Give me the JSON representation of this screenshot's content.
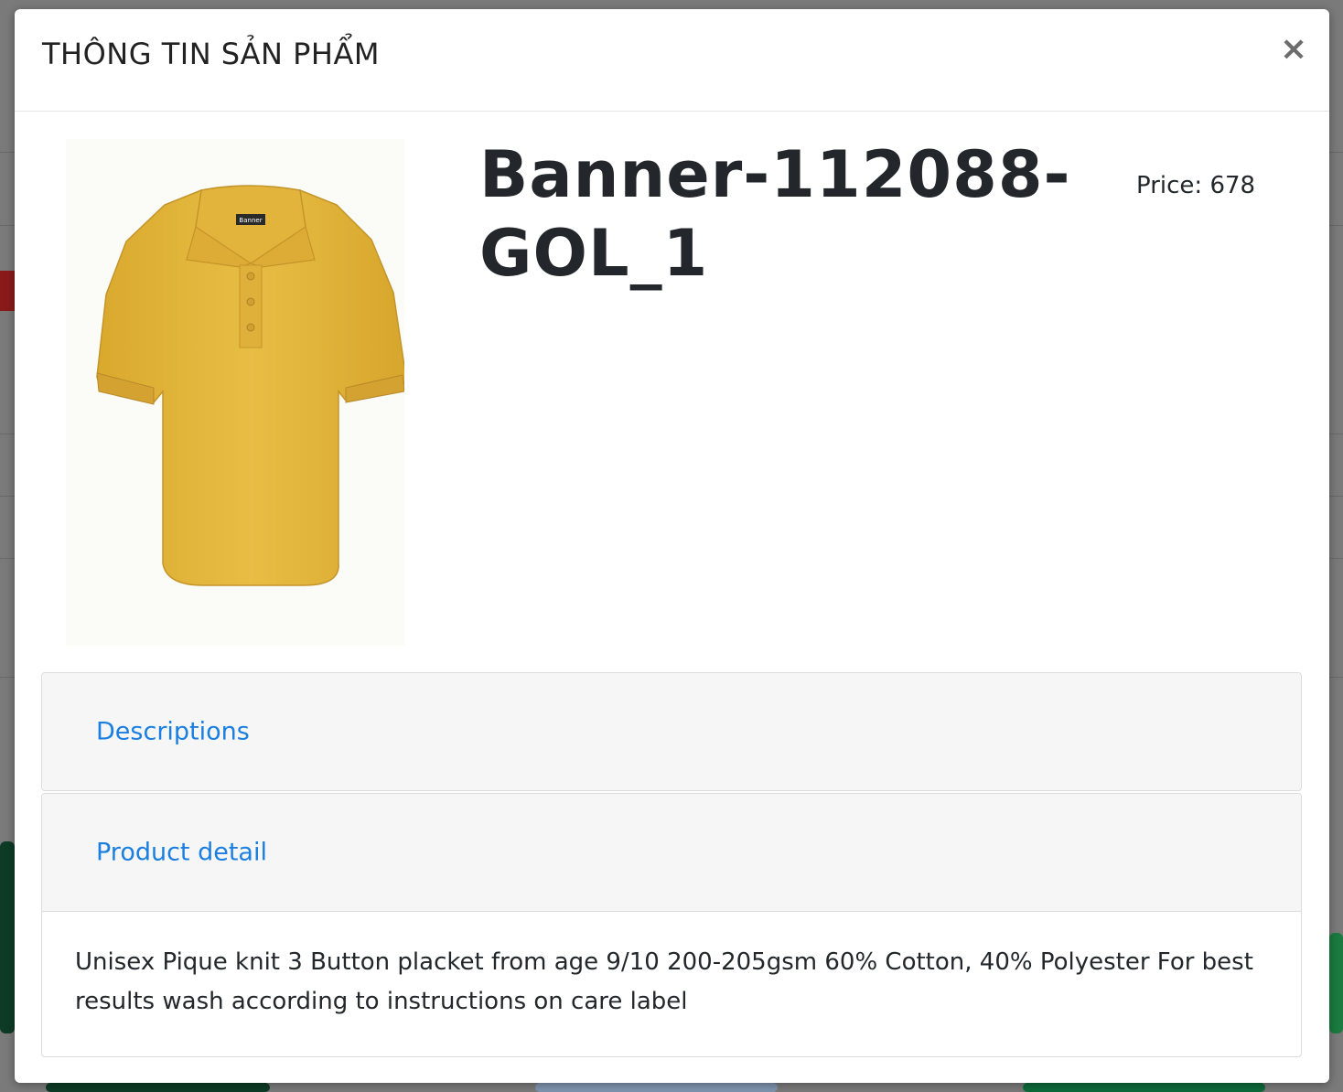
{
  "modal": {
    "title": "THÔNG TIN SẢN PHẨM",
    "close_label": "×"
  },
  "product": {
    "name_line1": "Banner-112088-",
    "name_line2": "GOL_1",
    "price_text": "Price: 678",
    "image_color": "#e7b93f",
    "brand_tag": "Banner"
  },
  "accordion": {
    "descriptions_label": "Descriptions",
    "product_detail_label": "Product detail",
    "product_detail_body": "Unisex Pique knit 3 Button placket from age 9/10 200-205gsm 60% Cotton, 40% Polyester For best results wash according to instructions on care label"
  },
  "colors": {
    "link": "#1a7fe0",
    "backdrop": "#7a7a7a"
  }
}
